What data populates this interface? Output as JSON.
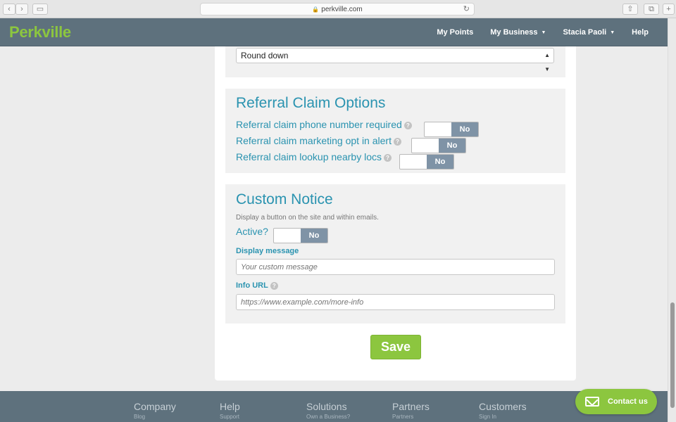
{
  "browser": {
    "url": "perkville.com",
    "back_icon": "chevron-left-icon",
    "forward_icon": "chevron-right-icon"
  },
  "header": {
    "logo": "Perkville",
    "nav": {
      "my_points": "My Points",
      "my_business": "My Business",
      "user": "Stacia Paoli",
      "help": "Help"
    }
  },
  "rounding": {
    "selected": "Round down"
  },
  "referral": {
    "title": "Referral Claim Options",
    "rows": [
      {
        "label": "Referral claim phone number required",
        "state": "No"
      },
      {
        "label": "Referral claim marketing opt in alert",
        "state": "No"
      },
      {
        "label": "Referral claim lookup nearby locs",
        "state": "No"
      }
    ]
  },
  "custom_notice": {
    "title": "Custom Notice",
    "description": "Display a button on the site and within emails.",
    "active_label": "Active?",
    "active_state": "No",
    "display_message_label": "Display message",
    "display_message_placeholder": "Your custom message",
    "info_url_label": "Info URL",
    "info_url_placeholder": "https://www.example.com/more-info"
  },
  "save_label": "Save",
  "footer": {
    "cols": [
      {
        "head": "Company",
        "sub": "Blog"
      },
      {
        "head": "Help",
        "sub": "Support"
      },
      {
        "head": "Solutions",
        "sub": "Own a Business?"
      },
      {
        "head": "Partners",
        "sub": "Partners"
      },
      {
        "head": "Customers",
        "sub": "Sign In"
      }
    ]
  },
  "contact_label": "Contact us",
  "colors": {
    "accent_green": "#8cc63f",
    "header_slate": "#5e717d",
    "title_blue": "#2a93b0",
    "toggle_off": "#7f93a6"
  }
}
